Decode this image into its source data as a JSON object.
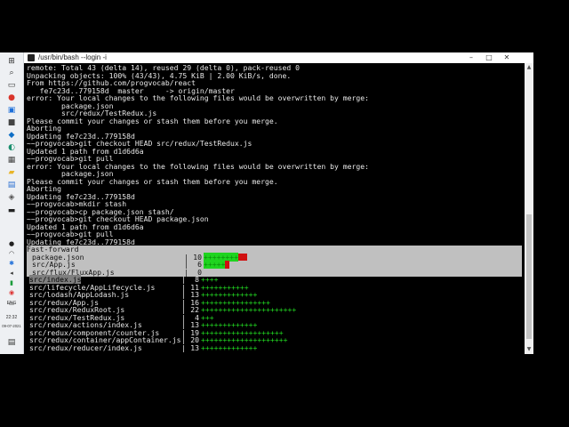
{
  "window": {
    "title": "/usr/bin/bash --login -i"
  },
  "icons": {
    "app": "terminal-icon",
    "minimize": "minimize-icon",
    "maximize": "maximize-icon",
    "close": "close-icon",
    "scroll_up": "scroll-up-icon",
    "scroll_down": "scroll-down-icon"
  },
  "taskbar": {
    "icons": [
      "start-icon",
      "search-icon",
      "task-view-icon",
      "chrome-icon",
      "monitor-icon",
      "app-icon",
      "shield-icon",
      "edge-icon",
      "calculator-icon",
      "folder-icon",
      "store-icon",
      "git-bash-icon",
      "terminal-icon"
    ],
    "tray_icons": [
      "microphone-icon",
      "wifi-icon",
      "bluetooth-icon",
      "speaker-icon",
      "battery-icon",
      "network-icon",
      "keyboard-icon"
    ],
    "language": "ENG",
    "time": "22:32",
    "date": "09-07-2021",
    "notification": "notification-icon"
  },
  "terminal": {
    "lines": [
      "remote: Total 43 (delta 14), reused 29 (delta 0), pack-reused 0",
      "Unpacking objects: 100% (43/43), 4.75 KiB | 2.00 KiB/s, done.",
      "From https://github.com/progvocab/react",
      "   fe7c23d..779158d  master     -> origin/master",
      "error: Your local changes to the following files would be overwritten by merge:",
      "        package.json",
      "        src/redux/TestRedux.js",
      "Please commit your changes or stash them before you merge.",
      "Aborting",
      "Updating fe7c23d..779158d",
      "~~progvocab>git checkout HEAD src/redux/TestRedux.js",
      "Updated 1 path from d1d6d6a",
      "~~progvocab>git pull",
      "error: Your local changes to the following files would be overwritten by merge:",
      "        package.json",
      "Please commit your changes or stash them before you merge.",
      "Aborting",
      "Updating fe7c23d..779158d",
      "~~progvocab>mkdir stash",
      "~~progvocab>cp package.json stash/",
      "~~progvocab>git checkout HEAD package.json",
      "Updated 1 path from d1d6d6a",
      "~~progvocab>git pull",
      "Updating fe7c23d..779158d"
    ],
    "fast_forward": "Fast-forward",
    "files": [
      {
        "name": "package.json",
        "count": "10",
        "bar": "++++++++",
        "red": "--",
        "highlight": true
      },
      {
        "name": "src/App.js",
        "count": "6",
        "bar": "+++++",
        "red": "-",
        "highlight": true
      },
      {
        "name": "src/flux/FluxApp.js",
        "count": "0",
        "bar": "",
        "red": "",
        "highlight": true
      },
      {
        "name": "src/index.js",
        "count": "8",
        "bar": "++++",
        "red": "",
        "highlight": false,
        "selected": true
      },
      {
        "name": "src/lifecycle/AppLifecycle.js",
        "count": "11",
        "bar": "+++++++++++",
        "red": "",
        "highlight": false
      },
      {
        "name": "src/lodash/AppLodash.js",
        "count": "13",
        "bar": "+++++++++++++",
        "red": "",
        "highlight": false
      },
      {
        "name": "src/redux/App.js",
        "count": "16",
        "bar": "++++++++++++++++",
        "red": "",
        "highlight": false
      },
      {
        "name": "src/redux/ReduxRoot.js",
        "count": "22",
        "bar": "++++++++++++++++++++++",
        "red": "",
        "highlight": false
      },
      {
        "name": "src/redux/TestRedux.js",
        "count": "4",
        "bar": "+++",
        "red": "",
        "highlight": false
      },
      {
        "name": "src/redux/actions/index.js",
        "count": "13",
        "bar": "+++++++++++++",
        "red": "",
        "highlight": false
      },
      {
        "name": "src/redux/component/counter.js",
        "count": "19",
        "bar": "+++++++++++++++++++",
        "red": "",
        "highlight": false
      },
      {
        "name": "src/redux/container/appContainer.js",
        "count": "20",
        "bar": "++++++++++++++++++++",
        "red": "",
        "highlight": false
      },
      {
        "name": "src/redux/reducer/index.js",
        "count": "13",
        "bar": "+++++++++++++",
        "red": "",
        "highlight": false
      }
    ]
  },
  "colors": {
    "bar_green": "#22dd22",
    "bar_red": "#d01010",
    "highlight": "#c0c0c0",
    "taskbar": "#eef0f3"
  }
}
